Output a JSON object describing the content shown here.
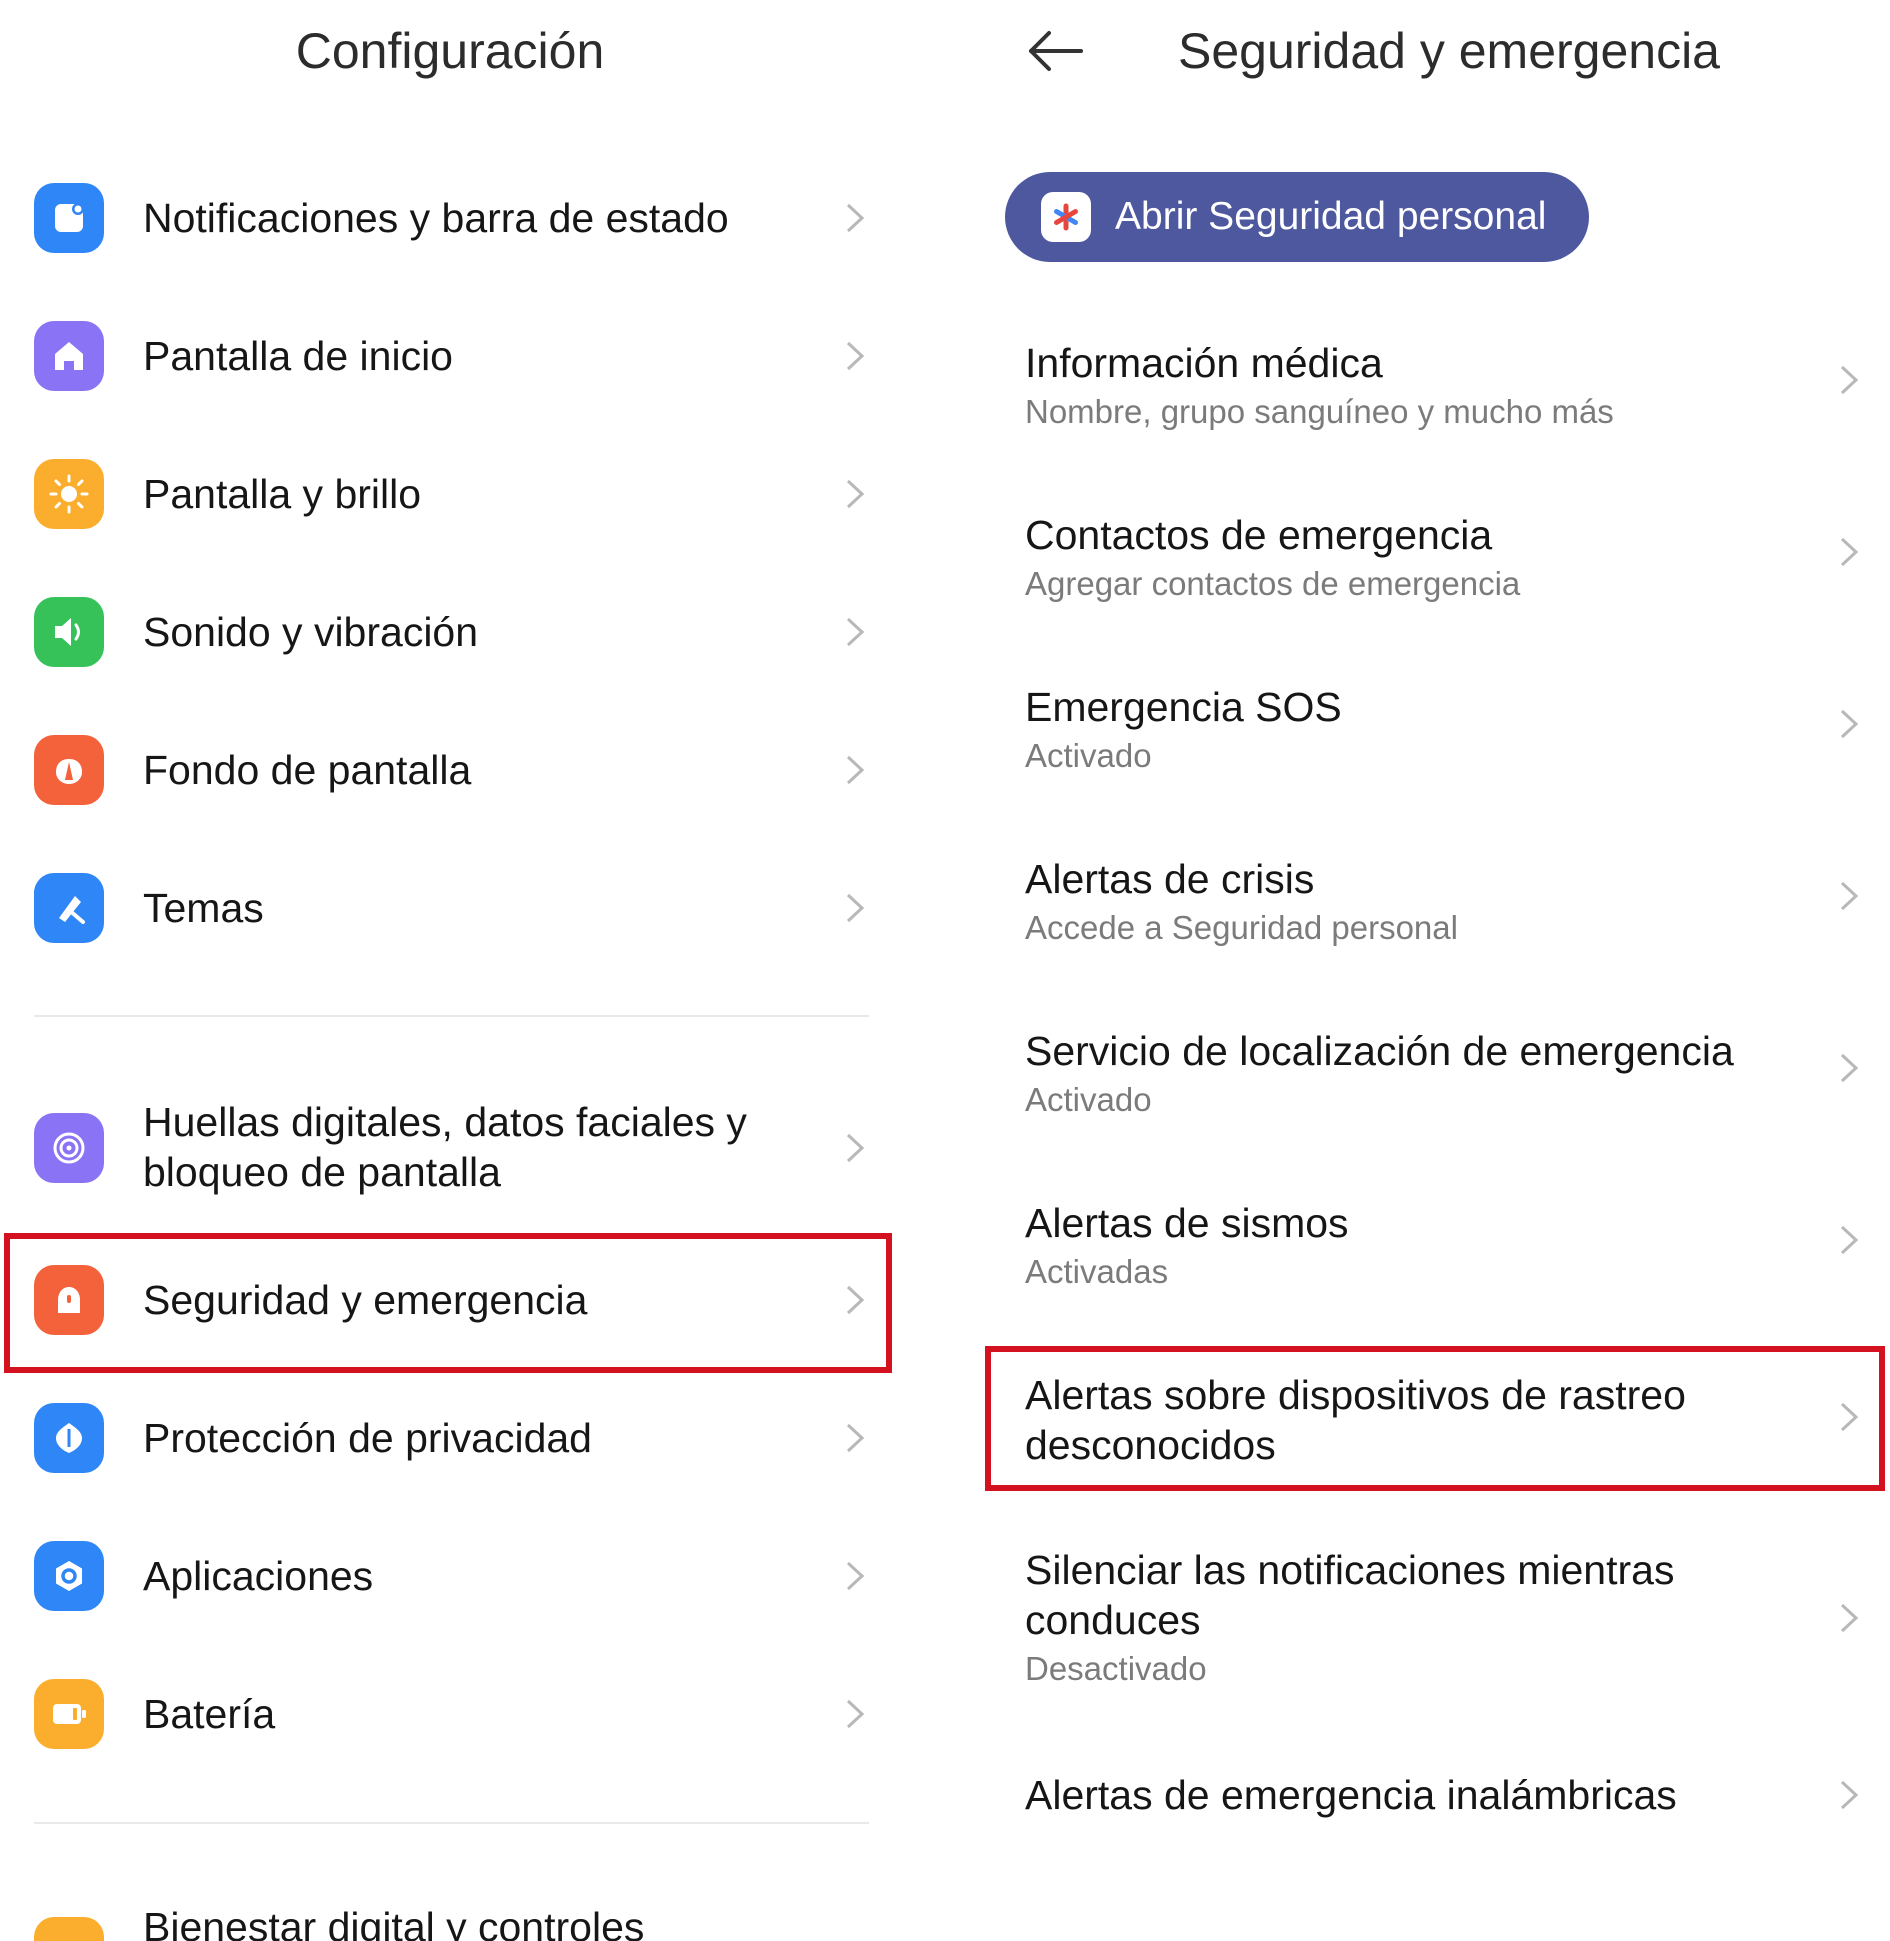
{
  "config": {
    "title": "Configuración",
    "items": [
      {
        "label": "Notificaciones y barra de estado"
      },
      {
        "label": "Pantalla de inicio"
      },
      {
        "label": "Pantalla y brillo"
      },
      {
        "label": "Sonido y vibración"
      },
      {
        "label": "Fondo de pantalla"
      },
      {
        "label": "Temas"
      },
      {
        "label": "Huellas digitales, datos faciales y",
        "label2": "bloqueo de pantalla"
      },
      {
        "label": "Seguridad y emergencia"
      },
      {
        "label": "Protección de privacidad"
      },
      {
        "label": "Aplicaciones"
      },
      {
        "label": "Batería"
      },
      {
        "label": "Bienestar digital y controles"
      }
    ]
  },
  "security": {
    "title": "Seguridad y emergencia",
    "open_button": "Abrir Seguridad personal",
    "items": [
      {
        "title": "Información médica",
        "subtitle": "Nombre, grupo sanguíneo y mucho más"
      },
      {
        "title": "Contactos de emergencia",
        "subtitle": "Agregar contactos de emergencia"
      },
      {
        "title": "Emergencia SOS",
        "subtitle": "Activado"
      },
      {
        "title": "Alertas de crisis",
        "subtitle": "Accede a Seguridad personal"
      },
      {
        "title": "Servicio de localización de emergencia",
        "subtitle": "Activado"
      },
      {
        "title": "Alertas de sismos",
        "subtitle": "Activadas"
      },
      {
        "title": "Alertas sobre dispositivos de rastreo",
        "title2": "desconocidos"
      },
      {
        "title": "Silenciar las notificaciones mientras",
        "title2": "conduces",
        "subtitle": "Desactivado"
      },
      {
        "title": "Alertas de emergencia inalámbricas"
      }
    ]
  },
  "colors": {
    "highlight": "#d4121f",
    "pill": "#4d589f",
    "icon_notificaciones": "#2f86f6",
    "icon_inicio": "#8a73f5",
    "icon_brillo": "#fbae2d",
    "icon_sonido": "#36c159",
    "icon_fondo": "#f3623a",
    "icon_temas": "#2f86f6",
    "icon_huellas": "#8a73f5",
    "icon_seguridad": "#f3623a",
    "icon_privacidad": "#2f86f6",
    "icon_aplicaciones": "#2f86f6",
    "icon_bateria": "#fbae2d",
    "icon_bienestar": "#fbae2d"
  },
  "icons": [
    "notification-icon",
    "home-icon",
    "brightness-icon",
    "sound-icon",
    "wallpaper-icon",
    "themes-icon",
    "fingerprint-icon",
    "security-icon",
    "privacy-icon",
    "apps-icon",
    "battery-icon",
    "wellbeing-icon",
    "back-arrow-icon",
    "personal-safety-icon",
    "chevron-right-icon"
  ]
}
